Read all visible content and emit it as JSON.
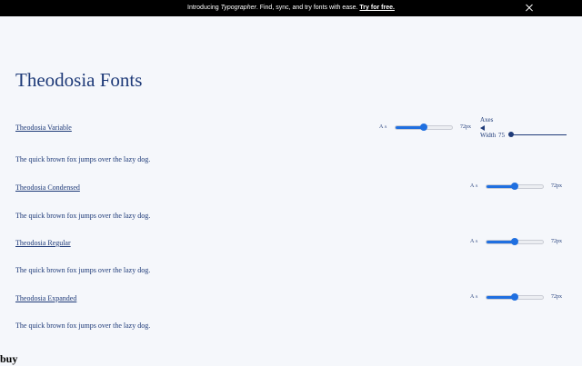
{
  "banner": {
    "text_before": "Introducing ",
    "product": "Typographer",
    "text_after": ". Find, sync, and try fonts with ease. ",
    "cta": "Try for free."
  },
  "page_title": "Theodosia Fonts",
  "fonts": [
    {
      "name": "Theodosia Variable",
      "sample": "The quick brown fox jumps over the lazy dog.",
      "size_label": "72px",
      "size_fraction": 0.5
    },
    {
      "name": "Theodosia Condensed",
      "sample": "The quick brown fox jumps over the lazy dog.",
      "size_label": "72px",
      "size_fraction": 0.5
    },
    {
      "name": "Theodosia Regular",
      "sample": "The quick brown fox jumps over the lazy dog.",
      "size_label": "72px",
      "size_fraction": 0.5
    },
    {
      "name": "Theodosia Expanded",
      "sample": "The quick brown fox jumps over the lazy dog.",
      "size_label": "72px",
      "size_fraction": 0.5
    }
  ],
  "size_icon": {
    "big": "A",
    "small": "A"
  },
  "axes": {
    "label": "Axes",
    "width_label": "Width",
    "width_value": "75",
    "width_fraction": 0.0
  },
  "footer_word": "buy",
  "colors": {
    "accent": "#1f6fe0",
    "text": "#1e3a78",
    "background": "#f5f7fb",
    "banner": "#000000"
  }
}
